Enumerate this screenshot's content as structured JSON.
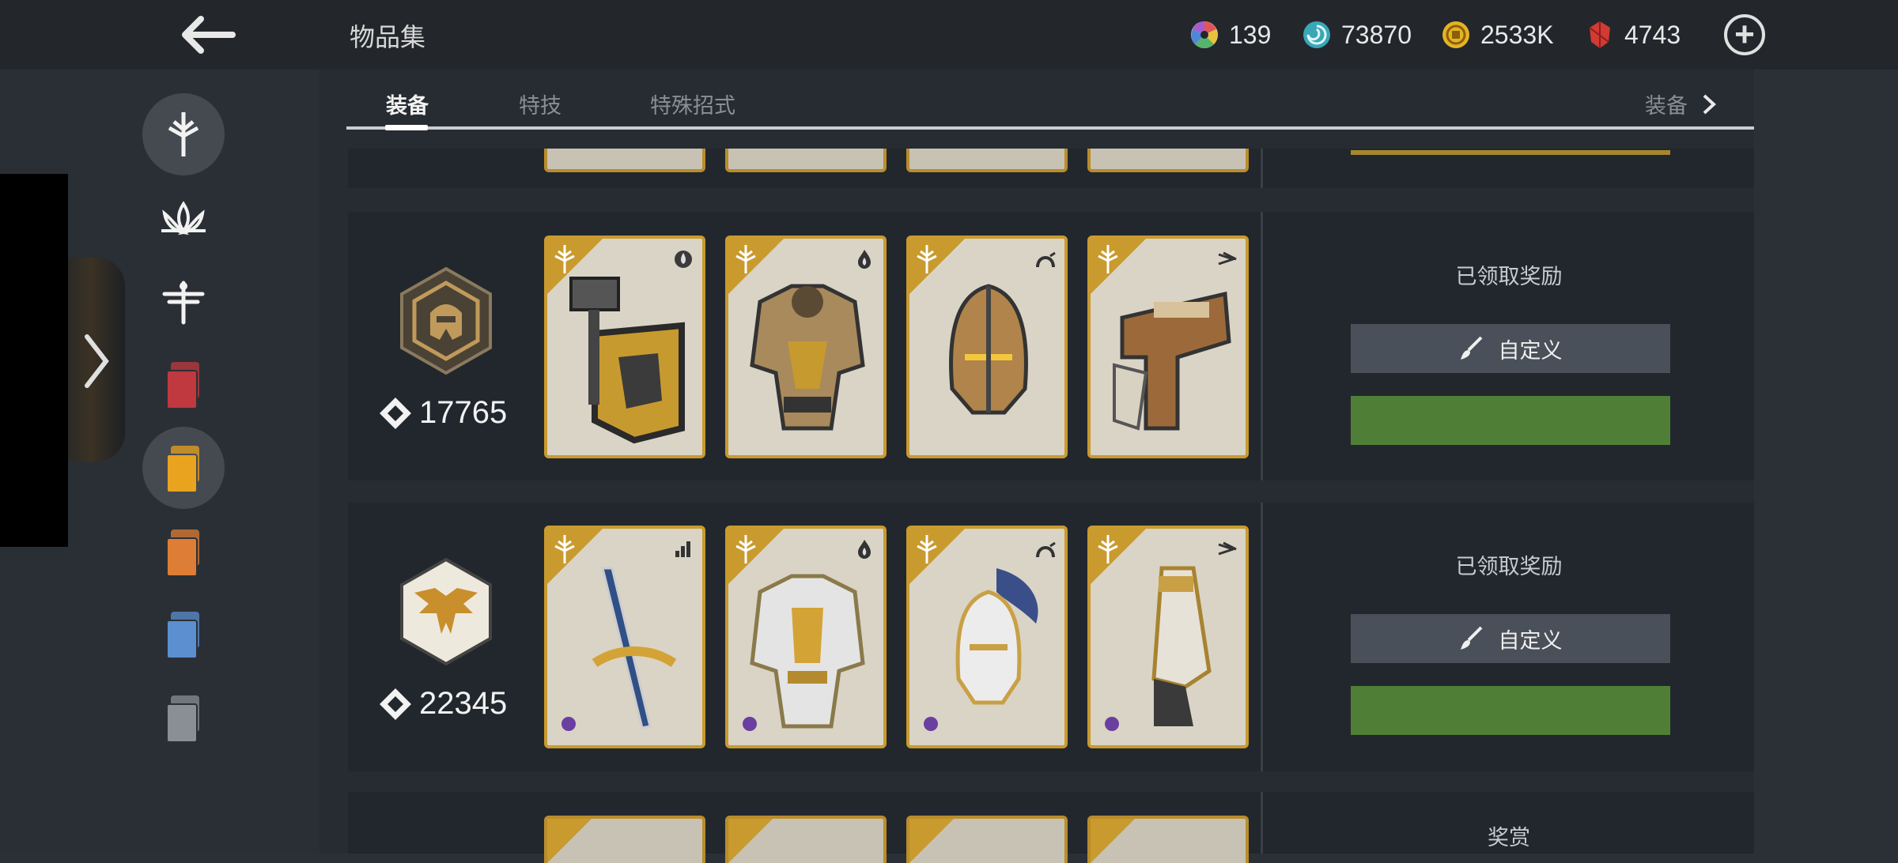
{
  "header": {
    "title": "物品集",
    "currencies": [
      {
        "icon": "color-wheel-icon",
        "value": "139"
      },
      {
        "icon": "spiral-orb-icon",
        "value": "73870"
      },
      {
        "icon": "gold-coin-icon",
        "value": "2533K"
      },
      {
        "icon": "ruby-gem-icon",
        "value": "4743"
      }
    ]
  },
  "tabs": {
    "items": [
      "装备",
      "特技",
      "特殊招式"
    ],
    "active": "装备",
    "right_label": "装备"
  },
  "sidebar": {
    "items": [
      {
        "icon": "sword-emblem-icon",
        "selected": true
      },
      {
        "icon": "lotus-icon",
        "selected": false
      },
      {
        "icon": "dragonfly-icon",
        "selected": false
      },
      {
        "icon": "red-cards-icon",
        "selected": false,
        "color": "#c0393f"
      },
      {
        "icon": "yellow-cards-icon",
        "selected": true,
        "color": "#e9a31f"
      },
      {
        "icon": "orange-cards-icon",
        "selected": false,
        "color": "#de7d35"
      },
      {
        "icon": "blue-cards-icon",
        "selected": false,
        "color": "#5b8fd0"
      },
      {
        "icon": "gray-cards-icon",
        "selected": false,
        "color": "#8a8f96"
      }
    ]
  },
  "sets": [
    {
      "badge_icon": "helmet-hex-badge-icon",
      "score": "17765",
      "items": [
        {
          "name": "hammer-shield",
          "type_icon": "drop-icon"
        },
        {
          "name": "gold-armor",
          "type_icon": "flame-icon"
        },
        {
          "name": "gold-helmet",
          "type_icon": "arc-icon"
        },
        {
          "name": "gold-pistol",
          "type_icon": "arrows-icon"
        }
      ],
      "status": "已领取奖励",
      "customize_label": "自定义"
    },
    {
      "badge_icon": "eagle-hex-badge-icon",
      "score": "22345",
      "items": [
        {
          "name": "longsword",
          "type_icon": "bars-icon"
        },
        {
          "name": "knight-armor",
          "type_icon": "flame-icon"
        },
        {
          "name": "winged-helmet",
          "type_icon": "arc-icon"
        },
        {
          "name": "cannon-arm",
          "type_icon": "arrows-icon"
        }
      ],
      "status": "已领取奖励",
      "customize_label": "自定义"
    }
  ],
  "next_set_label": "奖赏",
  "colors": {
    "gold_frame": "#c99a2e",
    "green_button": "#4f7f37",
    "button_gray": "#4a5059",
    "rarity_purple": "#6a3fa0"
  }
}
